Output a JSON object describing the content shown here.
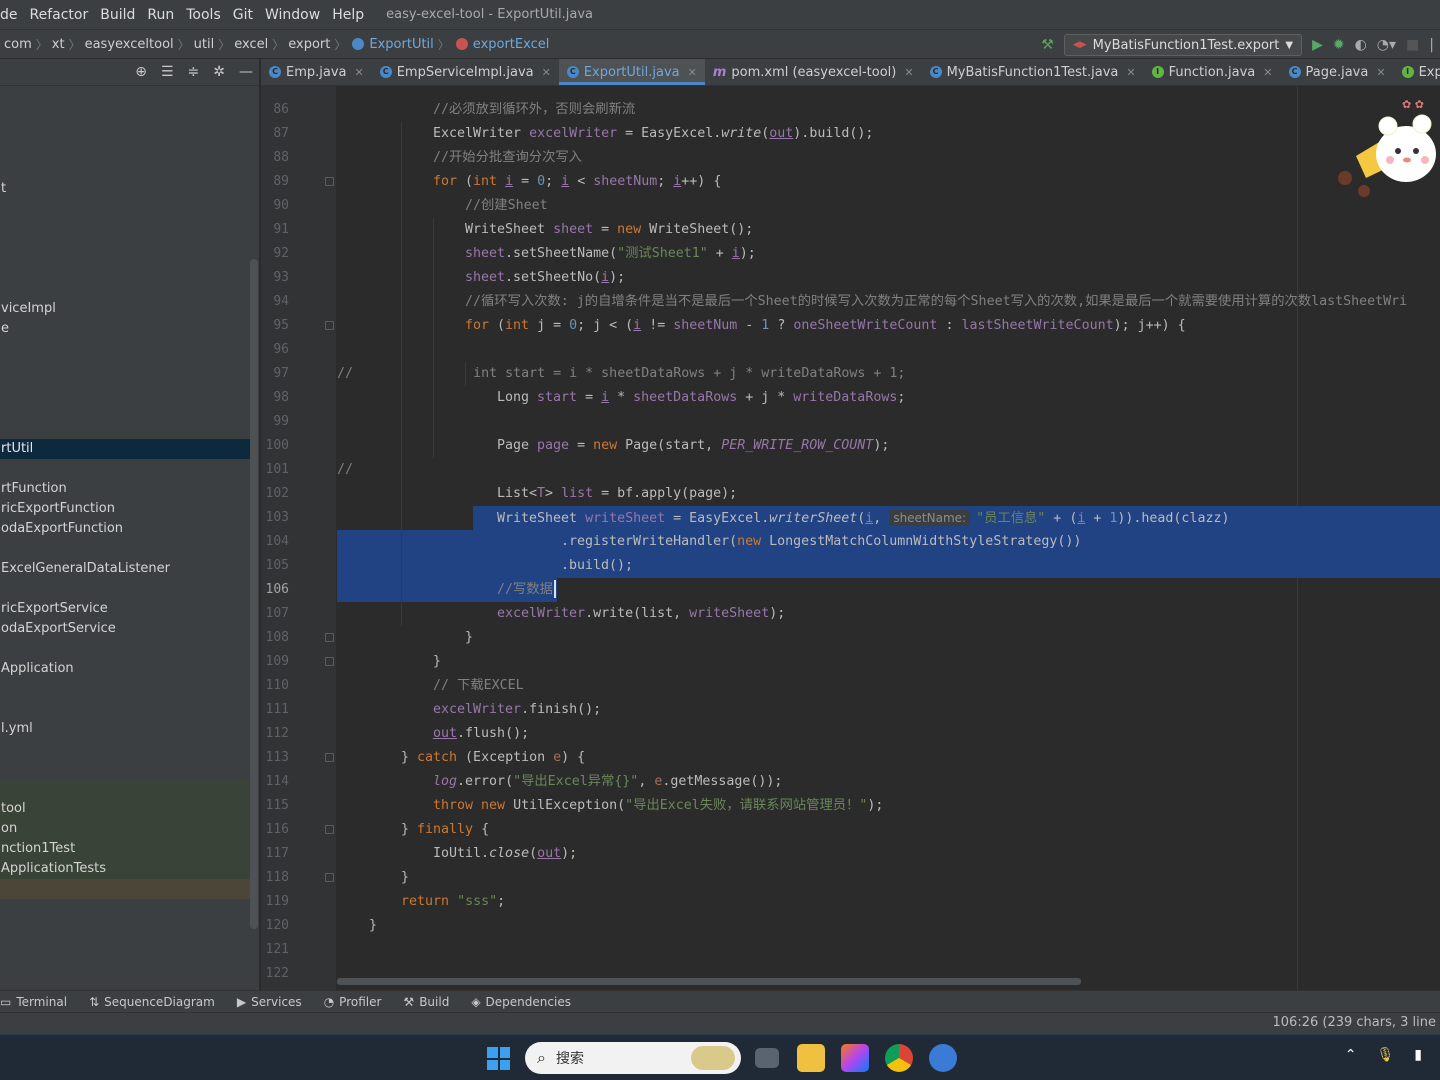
{
  "menu": {
    "items": [
      "de",
      "Refactor",
      "Build",
      "Run",
      "Tools",
      "Git",
      "Window",
      "Help"
    ],
    "window_title": "easy-excel-tool - ExportUtil.java"
  },
  "breadcrumb": {
    "items": [
      "com",
      "xt",
      "easyexceltool",
      "util",
      "excel",
      "export"
    ],
    "class_name": "ExportUtil",
    "method_name": "exportExcel"
  },
  "run_config": {
    "label": "MyBatisFunction1Test.export"
  },
  "tabs": [
    {
      "label": "Emp.java",
      "color": "#4a88c7",
      "active": false
    },
    {
      "label": "EmpServiceImpl.java",
      "color": "#4a88c7",
      "active": false
    },
    {
      "label": "ExportUtil.java",
      "color": "#4a88c7",
      "active": true
    },
    {
      "label": "pom.xml (easyexcel-tool)",
      "color": "#b07ad6",
      "active": false
    },
    {
      "label": "MyBatisFunction1Test.java",
      "color": "#4a88c7",
      "active": false
    },
    {
      "label": "Function.java",
      "color": "#62b543",
      "active": false
    },
    {
      "label": "Page.java",
      "color": "#4a88c7",
      "active": false
    },
    {
      "label": "ExportFunctic",
      "color": "#62b543",
      "active": false
    }
  ],
  "tree": [
    {
      "label": "t",
      "selected": false
    },
    {
      "label": "viceImpl",
      "selected": false
    },
    {
      "label": "e",
      "selected": false
    },
    {
      "label": "rtUtil",
      "selected": true
    },
    {
      "label": "rtFunction",
      "selected": false
    },
    {
      "label": "ricExportFunction",
      "selected": false
    },
    {
      "label": "odaExportFunction",
      "selected": false
    },
    {
      "label": "ExcelGeneralDataListener",
      "selected": false
    },
    {
      "label": "ricExportService",
      "selected": false
    },
    {
      "label": "odaExportService",
      "selected": false
    },
    {
      "label": "Application",
      "selected": false
    },
    {
      "label": "l.yml",
      "selected": false
    },
    {
      "label": "tool",
      "selected": false
    },
    {
      "label": "on",
      "selected": false
    },
    {
      "label": "nction1Test",
      "selected": false
    },
    {
      "label": "ApplicationTests",
      "selected": false
    }
  ],
  "editor": {
    "current_line": "106",
    "hint_label": "sheetName:",
    "lines": [
      {
        "n": "86",
        "indent": 3,
        "tokens": [
          [
            "cm",
            "//必须放到循环外，否则会刷新流"
          ]
        ]
      },
      {
        "n": "87",
        "indent": 3,
        "tokens": [
          [
            "",
            "ExcelWriter "
          ],
          [
            "fld",
            "excelWriter"
          ],
          [
            "",
            " = EasyExcel."
          ],
          [
            "it",
            "write"
          ],
          [
            "",
            "("
          ],
          [
            "fld ul",
            "out"
          ],
          [
            "",
            ")."
          ],
          [
            "",
            "build"
          ],
          [
            "",
            "();"
          ]
        ]
      },
      {
        "n": "88",
        "indent": 3,
        "tokens": [
          [
            "cm",
            "//开始分批查询分次写入"
          ]
        ]
      },
      {
        "n": "89",
        "indent": 3,
        "tokens": [
          [
            "kw",
            "for"
          ],
          [
            "",
            " ("
          ],
          [
            "kw",
            "int"
          ],
          [
            "",
            " "
          ],
          [
            "fld ul",
            "i"
          ],
          [
            "",
            " = "
          ],
          [
            "num",
            "0"
          ],
          [
            "",
            "; "
          ],
          [
            "fld ul",
            "i"
          ],
          [
            "",
            " < "
          ],
          [
            "fld",
            "sheetNum"
          ],
          [
            "",
            "; "
          ],
          [
            "fld ul",
            "i"
          ],
          [
            "",
            "++) {"
          ]
        ]
      },
      {
        "n": "90",
        "indent": 4,
        "tokens": [
          [
            "cm",
            "//创建Sheet"
          ]
        ]
      },
      {
        "n": "91",
        "indent": 4,
        "tokens": [
          [
            "",
            "WriteSheet "
          ],
          [
            "fld",
            "sheet"
          ],
          [
            "",
            " = "
          ],
          [
            "kw",
            "new"
          ],
          [
            "",
            " WriteSheet();"
          ]
        ]
      },
      {
        "n": "92",
        "indent": 4,
        "tokens": [
          [
            "fld",
            "sheet"
          ],
          [
            "",
            ".setSheetName("
          ],
          [
            "str",
            "\"测试Sheet1\""
          ],
          [
            "",
            " + "
          ],
          [
            "fld ul",
            "i"
          ],
          [
            "",
            ");"
          ]
        ]
      },
      {
        "n": "93",
        "indent": 4,
        "tokens": [
          [
            "fld",
            "sheet"
          ],
          [
            "",
            ".setSheetNo("
          ],
          [
            "fld ul",
            "i"
          ],
          [
            "",
            ");"
          ]
        ]
      },
      {
        "n": "94",
        "indent": 4,
        "tokens": [
          [
            "cm",
            "//循环写入次数: j的自增条件是当不是最后一个Sheet的时候写入次数为正常的每个Sheet写入的次数,如果是最后一个就需要使用计算的次数lastSheetWri"
          ]
        ]
      },
      {
        "n": "95",
        "indent": 4,
        "tokens": [
          [
            "kw",
            "for"
          ],
          [
            "",
            " ("
          ],
          [
            "kw",
            "int"
          ],
          [
            "",
            " j = "
          ],
          [
            "num",
            "0"
          ],
          [
            "",
            "; j < ("
          ],
          [
            "fld ul",
            "i"
          ],
          [
            "",
            " != "
          ],
          [
            "fld",
            "sheetNum"
          ],
          [
            "",
            " - "
          ],
          [
            "num",
            "1"
          ],
          [
            "",
            " ? "
          ],
          [
            "fld",
            "oneSheetWriteCount"
          ],
          [
            "",
            " : "
          ],
          [
            "fld",
            "lastSheetWriteCount"
          ],
          [
            "",
            "); j++) {"
          ]
        ]
      },
      {
        "n": "96",
        "indent": 0,
        "tokens": []
      },
      {
        "n": "97",
        "indent": 0,
        "tokens": [
          [
            "cm",
            "//               int start = i * sheetDataRows + j * writeDataRows + 1;"
          ]
        ]
      },
      {
        "n": "98",
        "indent": 5,
        "tokens": [
          [
            "",
            "Long "
          ],
          [
            "fld",
            "start"
          ],
          [
            "",
            " = "
          ],
          [
            "fld ul",
            "i"
          ],
          [
            "",
            " * "
          ],
          [
            "fld",
            "sheetDataRows"
          ],
          [
            "",
            " + j * "
          ],
          [
            "fld",
            "writeDataRows"
          ],
          [
            "",
            ";"
          ]
        ]
      },
      {
        "n": "99",
        "indent": 0,
        "tokens": []
      },
      {
        "n": "100",
        "indent": 5,
        "tokens": [
          [
            "",
            "Page "
          ],
          [
            "fld",
            "page"
          ],
          [
            "",
            " = "
          ],
          [
            "kw",
            "new"
          ],
          [
            "",
            " Page(start, "
          ],
          [
            "fld it",
            "PER_WRITE_ROW_COUNT"
          ],
          [
            "",
            ");"
          ]
        ]
      },
      {
        "n": "101",
        "indent": 0,
        "tokens": [
          [
            "cm",
            "//"
          ]
        ]
      },
      {
        "n": "102",
        "indent": 5,
        "tokens": [
          [
            "",
            "List<"
          ],
          [
            "fld",
            "T"
          ],
          [
            "",
            "> "
          ],
          [
            "fld",
            "list"
          ],
          [
            "",
            " = bf.apply(page);"
          ]
        ]
      },
      {
        "n": "103",
        "indent": 5,
        "tokens": [
          [
            "",
            "WriteSheet "
          ],
          [
            "fld",
            "writeSheet"
          ],
          [
            "",
            " = EasyExcel."
          ],
          [
            "it",
            "writerSheet"
          ],
          [
            "",
            "("
          ],
          [
            "fld ul",
            "i"
          ],
          [
            "",
            ", "
          ],
          [
            "hint",
            "sheetName:"
          ],
          [
            "str",
            "\"员工信息\""
          ],
          [
            "",
            " + ("
          ],
          [
            "fld ul",
            "i"
          ],
          [
            "",
            " + "
          ],
          [
            "num",
            "1"
          ],
          [
            "",
            ")).head(clazz)"
          ]
        ]
      },
      {
        "n": "104",
        "indent": 7,
        "tokens": [
          [
            "",
            ".registerWriteHandler("
          ],
          [
            "kw",
            "new"
          ],
          [
            "",
            " LongestMatchColumnWidthStyleStrategy())"
          ]
        ]
      },
      {
        "n": "105",
        "indent": 7,
        "tokens": [
          [
            "",
            ".build();"
          ]
        ]
      },
      {
        "n": "106",
        "indent": 5,
        "tokens": [
          [
            "cm",
            "//写数据"
          ]
        ]
      },
      {
        "n": "107",
        "indent": 5,
        "tokens": [
          [
            "fld",
            "excelWriter"
          ],
          [
            "",
            ".write(list, "
          ],
          [
            "fld",
            "writeSheet"
          ],
          [
            "",
            ");"
          ]
        ]
      },
      {
        "n": "108",
        "indent": 4,
        "tokens": [
          [
            "",
            "}"
          ]
        ]
      },
      {
        "n": "109",
        "indent": 3,
        "tokens": [
          [
            "",
            "}"
          ]
        ]
      },
      {
        "n": "110",
        "indent": 3,
        "tokens": [
          [
            "cm",
            "// 下载EXCEL"
          ]
        ]
      },
      {
        "n": "111",
        "indent": 3,
        "tokens": [
          [
            "fld",
            "excelWriter"
          ],
          [
            "",
            ".finish();"
          ]
        ]
      },
      {
        "n": "112",
        "indent": 3,
        "tokens": [
          [
            "fld ul",
            "out"
          ],
          [
            "",
            ".flush();"
          ]
        ]
      },
      {
        "n": "113",
        "indent": 2,
        "tokens": [
          [
            "",
            "} "
          ],
          [
            "kw",
            "catch"
          ],
          [
            "",
            " (Exception "
          ],
          [
            "param",
            "e"
          ],
          [
            "",
            ") {"
          ]
        ]
      },
      {
        "n": "114",
        "indent": 3,
        "tokens": [
          [
            "fld it",
            "log"
          ],
          [
            "",
            ".error("
          ],
          [
            "str",
            "\"导出Excel异常{}\""
          ],
          [
            "",
            ", "
          ],
          [
            "param",
            "e"
          ],
          [
            "",
            ".getMessage());"
          ]
        ]
      },
      {
        "n": "115",
        "indent": 3,
        "tokens": [
          [
            "kw",
            "throw new"
          ],
          [
            "",
            " UtilException("
          ],
          [
            "str",
            "\"导出Excel失败，请联系网站管理员！\""
          ],
          [
            "",
            ");"
          ]
        ]
      },
      {
        "n": "116",
        "indent": 2,
        "tokens": [
          [
            "",
            "} "
          ],
          [
            "kw",
            "finally"
          ],
          [
            "",
            " {"
          ]
        ]
      },
      {
        "n": "117",
        "indent": 3,
        "tokens": [
          [
            "",
            "IoUtil."
          ],
          [
            "it",
            "close"
          ],
          [
            "",
            "("
          ],
          [
            "fld ul",
            "out"
          ],
          [
            "",
            ");"
          ]
        ]
      },
      {
        "n": "118",
        "indent": 2,
        "tokens": [
          [
            "",
            "}"
          ]
        ]
      },
      {
        "n": "119",
        "indent": 2,
        "tokens": [
          [
            "kw",
            "return"
          ],
          [
            "",
            " "
          ],
          [
            "str",
            "\"sss\""
          ],
          [
            "",
            ";"
          ]
        ]
      },
      {
        "n": "120",
        "indent": 1,
        "tokens": [
          [
            "",
            "}"
          ]
        ]
      },
      {
        "n": "121",
        "indent": 0,
        "tokens": []
      },
      {
        "n": "122",
        "indent": 0,
        "tokens": []
      }
    ]
  },
  "bottom_tools": [
    "Terminal",
    "SequenceDiagram",
    "Services",
    "Profiler",
    "Build",
    "Dependencies"
  ],
  "status": {
    "position": "106:26 (239 chars, 3 line"
  },
  "taskbar": {
    "search_placeholder": "搜索"
  },
  "colors": {
    "accent": "#4a88c7",
    "selection": "#214283",
    "background": "#2b2b2b"
  }
}
